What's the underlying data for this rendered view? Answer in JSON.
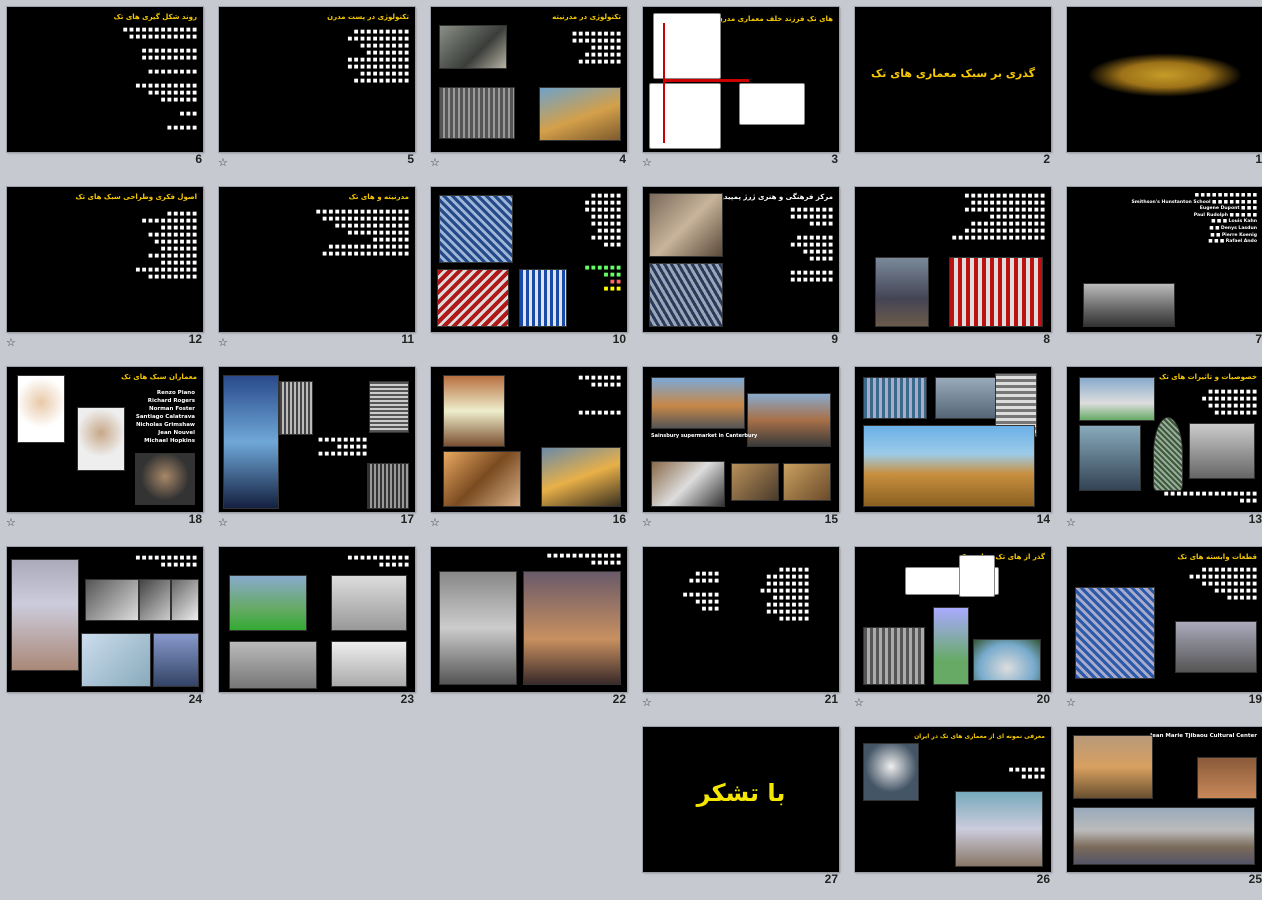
{
  "slides": [
    {
      "n": "1",
      "title": "",
      "star": false
    },
    {
      "n": "2",
      "title": "گذری بر سبک معماری های تک",
      "star": false
    },
    {
      "n": "3",
      "title": "های تک فرزند خلف معماری مدرن",
      "star": true
    },
    {
      "n": "4",
      "title": "تکنولوژی در مدرنیته",
      "star": true
    },
    {
      "n": "5",
      "title": "تکنولوژی در پست مدرن",
      "star": true
    },
    {
      "n": "6",
      "title": "روند شکل گیری های تک",
      "star": false
    },
    {
      "n": "7",
      "title": "",
      "star": false
    },
    {
      "n": "8",
      "title": "",
      "star": false
    },
    {
      "n": "9",
      "title": "مرکز فرهنگی و هنری ژرژ پمپیدو",
      "star": false
    },
    {
      "n": "10",
      "title": "",
      "star": false
    },
    {
      "n": "11",
      "title": "مدرنیته و های تک",
      "star": true
    },
    {
      "n": "12",
      "title": "اصول فکری وطراحی سبک های تک",
      "star": true
    },
    {
      "n": "13",
      "title": "خصوصیات و تاثیرات های تک",
      "star": true
    },
    {
      "n": "14",
      "title": "",
      "star": false
    },
    {
      "n": "15",
      "title": "",
      "star": true
    },
    {
      "n": "16",
      "title": "",
      "star": true
    },
    {
      "n": "17",
      "title": "",
      "star": true
    },
    {
      "n": "18",
      "title": "معماران سبک های تک",
      "star": true
    },
    {
      "n": "19",
      "title": "قطعات وابسته های تک",
      "star": true
    },
    {
      "n": "20",
      "title": "گذر از های تک به لیت تک",
      "star": true
    },
    {
      "n": "21",
      "title": "",
      "star": true
    },
    {
      "n": "22",
      "title": "",
      "star": false
    },
    {
      "n": "23",
      "title": "",
      "star": false
    },
    {
      "n": "24",
      "title": "",
      "star": false
    },
    {
      "n": "25",
      "title": "",
      "star": false
    },
    {
      "n": "26",
      "title": "معرفی نمونه ای از معماری های تک در ایران",
      "star": false
    },
    {
      "n": "27",
      "title": "با تشکر",
      "star": false
    }
  ],
  "text": {
    "s18_names": [
      "Renzo Piano",
      "Richard Rogers",
      "Norman Foster",
      "Santiago Calatrava",
      "Nicholas Grimshaw",
      "Jean Nouvel",
      "Michael Hopkins"
    ],
    "s25_heading": "Jean Marie Tjibaou Cultural Center",
    "s7_names": [
      "Smithson's Hunstanton School",
      "Eugene Dupont",
      "Paul Rudolph",
      "Louis Kahn",
      "Denys Lasdun",
      "Pierre Koenig",
      "Rafael Ando",
      "Mies van der Rohe"
    ],
    "s15_caption": "Sainsbury supermarket in Canterbury",
    "s8_caption": "Lloyds of London"
  },
  "star_icon": "☆"
}
